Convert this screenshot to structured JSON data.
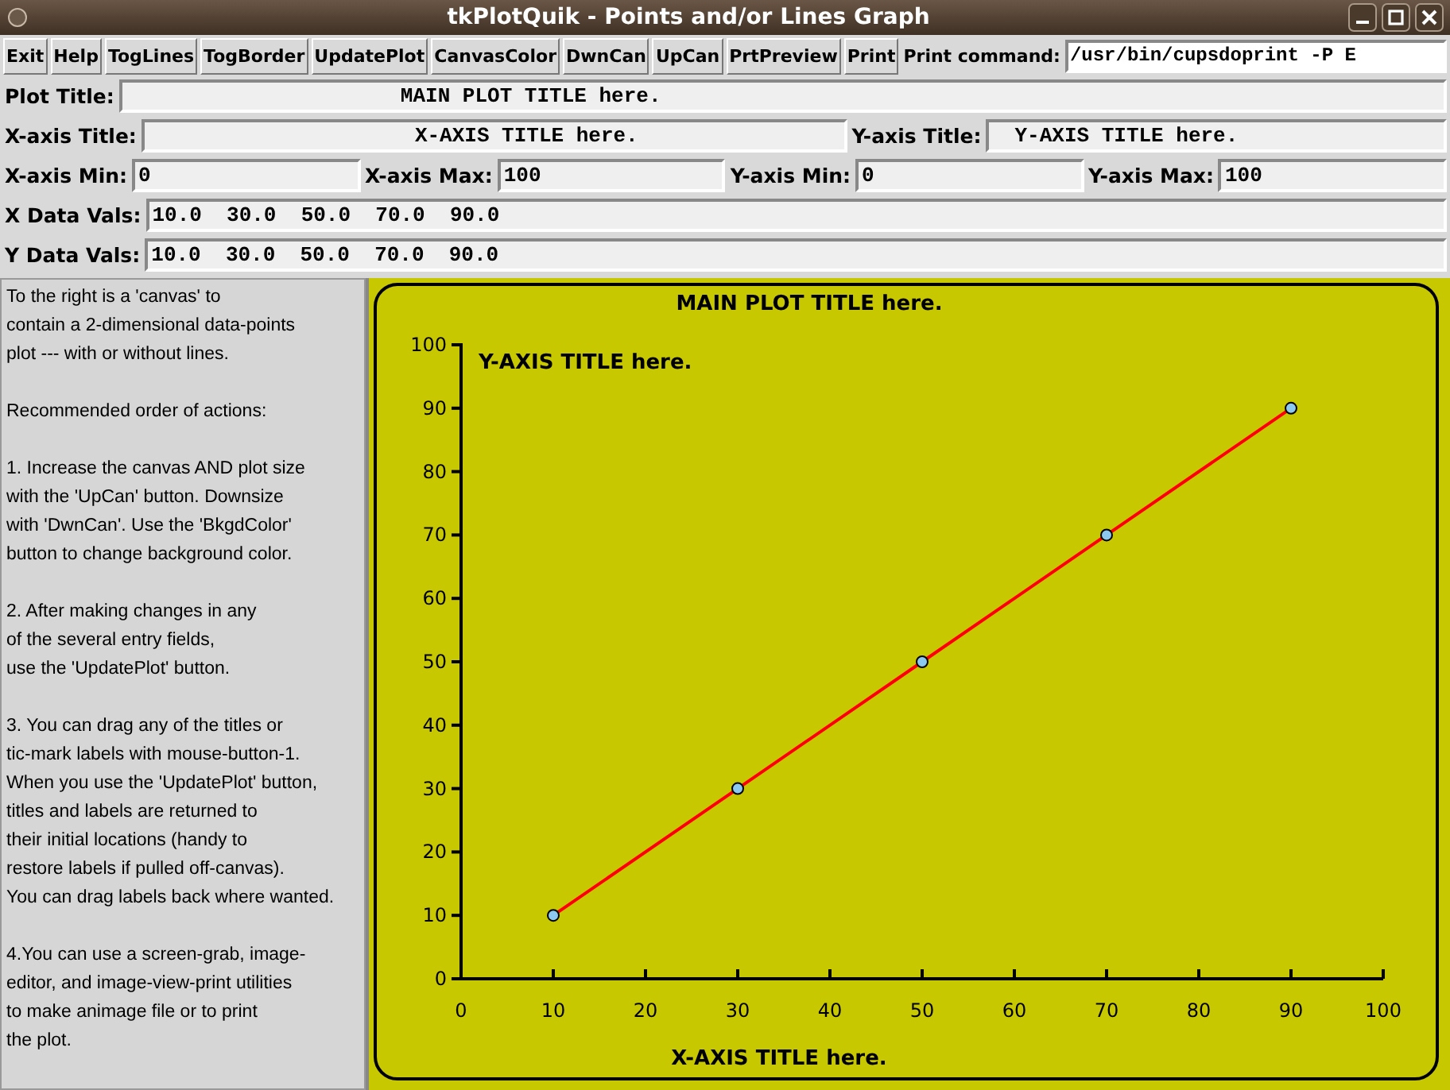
{
  "window": {
    "title": "tkPlotQuik - Points and/or Lines Graph"
  },
  "toolbar": {
    "buttons": [
      "Exit",
      "Help",
      "TogLines",
      "TogBorder",
      "UpdatePlot",
      "CanvasColor",
      "DwnCan",
      "UpCan",
      "PrtPreview",
      "Print"
    ],
    "print_command": {
      "label": "Print command:",
      "value": "/usr/bin/cupsdoprint -P E"
    }
  },
  "rows": [
    {
      "fields": [
        {
          "label": "Plot Title:",
          "value": "MAIN PLOT TITLE here."
        }
      ]
    },
    {
      "fields": [
        {
          "label": "X-axis Title:",
          "value": "X-AXIS TITLE here."
        },
        {
          "label": "Y-axis Title:",
          "value": "Y-AXIS TITLE here."
        }
      ]
    },
    {
      "fields": [
        {
          "label": "X-axis Min:",
          "value": "0"
        },
        {
          "label": "X-axis Max:",
          "value": "100"
        },
        {
          "label": "Y-axis Min:",
          "value": "0"
        },
        {
          "label": "Y-axis Max:",
          "value": "100"
        }
      ]
    },
    {
      "fields": [
        {
          "label": "X Data Vals:",
          "value": "10.0  30.0  50.0  70.0  90.0"
        }
      ]
    },
    {
      "fields": [
        {
          "label": "Y Data Vals:",
          "value": "10.0  30.0  50.0  70.0  90.0"
        }
      ]
    }
  ],
  "help_paragraphs": [
    "To the right is a 'canvas' to\ncontain a 2-dimensional data-points\nplot --- with or without lines.",
    "Recommended order of actions:",
    "1. Increase the canvas AND plot size\nwith the 'UpCan' button. Downsize\nwith 'DwnCan'. Use the 'BkgdColor'\nbutton to change background color.",
    "2. After making changes in any\nof the several entry fields,\nuse the 'UpdatePlot' button.",
    "3. You can drag any of the titles or\ntic-mark labels with mouse-button-1.\nWhen you use the 'UpdatePlot' button,\ntitles and labels are returned to\ntheir initial locations (handy to\nrestore labels if pulled off-canvas).\nYou can drag labels back where wanted.",
    "4.You can use a screen-grab, image-\neditor, and image-view-print utilities\nto make animage file or to print\nthe plot."
  ],
  "canvas": {
    "chart_data": {
      "type": "line",
      "title": "MAIN PLOT TITLE here.",
      "xlabel": "X-AXIS TITLE here.",
      "ylabel": "Y-AXIS TITLE here.",
      "x": [
        10,
        30,
        50,
        70,
        90
      ],
      "series": [
        {
          "color": "#ff0000",
          "marker": "circle",
          "values": [
            10,
            30,
            50,
            70,
            90
          ]
        }
      ],
      "xlim": [
        0,
        100
      ],
      "ylim": [
        0,
        100
      ],
      "xticks": [
        0,
        10,
        20,
        30,
        40,
        50,
        60,
        70,
        80,
        90,
        100
      ],
      "yticks": [
        0,
        10,
        20,
        30,
        40,
        50,
        60,
        70,
        80,
        90,
        100
      ]
    }
  }
}
